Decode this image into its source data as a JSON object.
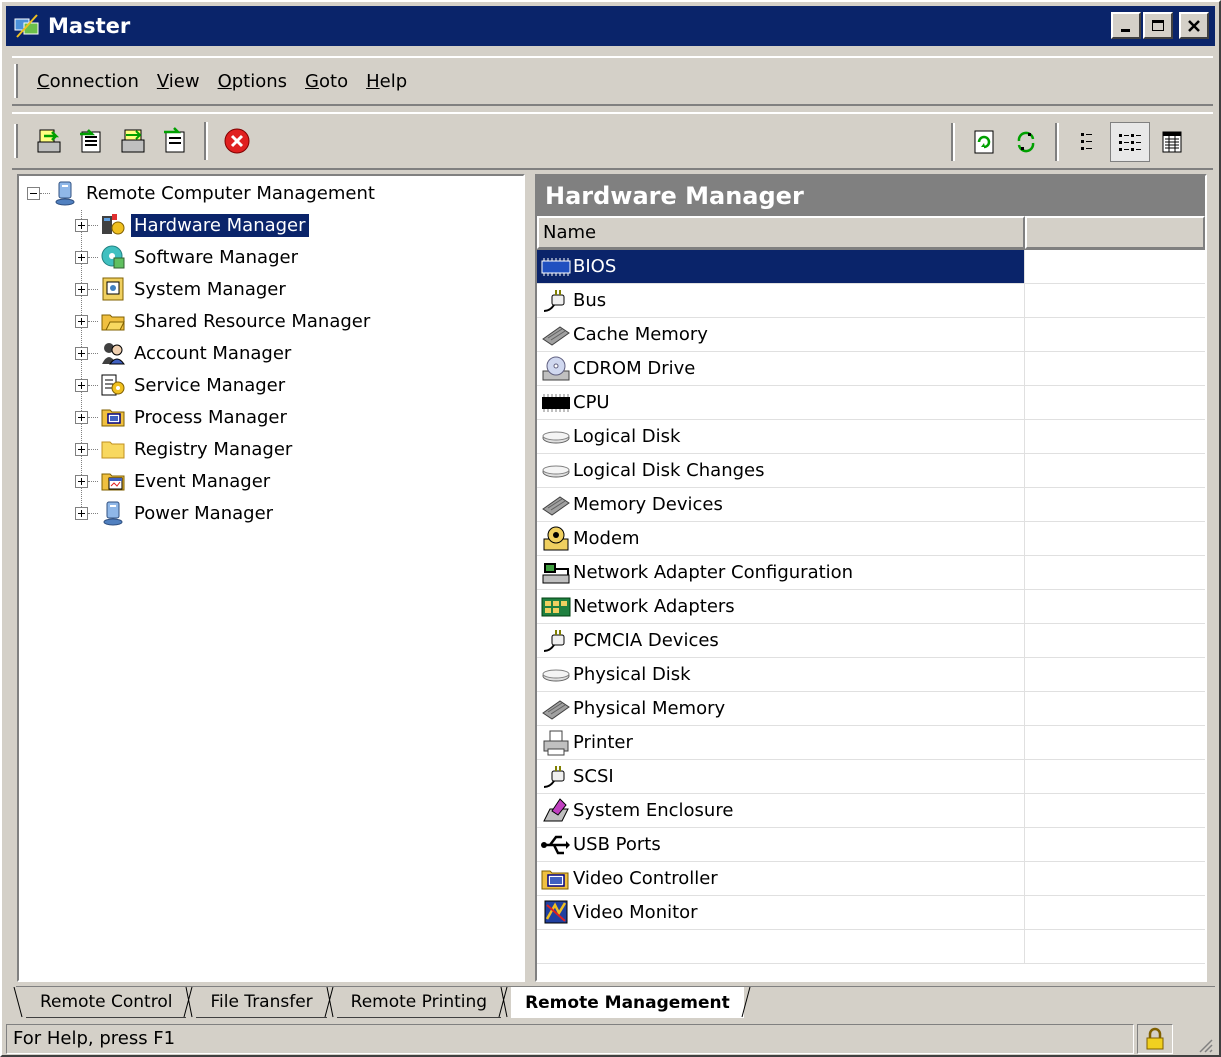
{
  "window": {
    "title": "Master"
  },
  "menu": [
    {
      "pre": "",
      "u": "C",
      "post": "onnection"
    },
    {
      "pre": "",
      "u": "V",
      "post": "iew"
    },
    {
      "pre": "",
      "u": "O",
      "post": "ptions"
    },
    {
      "pre": "",
      "u": "G",
      "post": "oto"
    },
    {
      "pre": "",
      "u": "H",
      "post": "elp"
    }
  ],
  "toolbar": {
    "left_buttons": [
      "connect-icon",
      "disconnect-icon",
      "connect-all-icon",
      "properties-icon",
      "stop-icon"
    ],
    "right_buttons": [
      "refresh-icon",
      "refresh-all-icon",
      "list-view-icon",
      "details-view-icon",
      "report-view-icon"
    ]
  },
  "tree": {
    "root": "Remote Computer Management",
    "items": [
      {
        "label": "Hardware Manager",
        "icon": "hardware-manager-icon",
        "selected": true
      },
      {
        "label": "Software Manager",
        "icon": "software-manager-icon"
      },
      {
        "label": "System Manager",
        "icon": "system-manager-icon"
      },
      {
        "label": "Shared Resource Manager",
        "icon": "shared-resource-icon"
      },
      {
        "label": "Account Manager",
        "icon": "account-manager-icon"
      },
      {
        "label": "Service Manager",
        "icon": "service-manager-icon"
      },
      {
        "label": "Process Manager",
        "icon": "process-manager-icon"
      },
      {
        "label": "Registry Manager",
        "icon": "registry-manager-icon"
      },
      {
        "label": "Event Manager",
        "icon": "event-manager-icon"
      },
      {
        "label": "Power Manager",
        "icon": "power-manager-icon"
      }
    ]
  },
  "panel": {
    "title": "Hardware Manager",
    "columns": [
      "Name",
      ""
    ],
    "rows": [
      {
        "name": "BIOS",
        "icon": "bios-chip-icon",
        "selected": true
      },
      {
        "name": "Bus",
        "icon": "bus-plug-icon"
      },
      {
        "name": "Cache Memory",
        "icon": "memory-module-icon"
      },
      {
        "name": "CDROM Drive",
        "icon": "cdrom-icon"
      },
      {
        "name": "CPU",
        "icon": "cpu-chip-icon"
      },
      {
        "name": "Logical Disk",
        "icon": "disk-icon"
      },
      {
        "name": "Logical Disk Changes",
        "icon": "disk-icon"
      },
      {
        "name": "Memory Devices",
        "icon": "memory-module-icon"
      },
      {
        "name": "Modem",
        "icon": "modem-icon"
      },
      {
        "name": "Network Adapter Configuration",
        "icon": "network-config-icon"
      },
      {
        "name": "Network Adapters",
        "icon": "network-adapter-icon"
      },
      {
        "name": "PCMCIA Devices",
        "icon": "bus-plug-icon"
      },
      {
        "name": "Physical Disk",
        "icon": "disk-icon"
      },
      {
        "name": "Physical Memory",
        "icon": "memory-module-icon"
      },
      {
        "name": "Printer",
        "icon": "printer-icon"
      },
      {
        "name": "SCSI",
        "icon": "bus-plug-icon"
      },
      {
        "name": "System Enclosure",
        "icon": "system-enclosure-icon"
      },
      {
        "name": "USB Ports",
        "icon": "usb-icon"
      },
      {
        "name": "Video Controller",
        "icon": "video-controller-icon"
      },
      {
        "name": "Video Monitor",
        "icon": "video-monitor-icon"
      }
    ]
  },
  "tabs": [
    {
      "label": "Remote Control",
      "active": false
    },
    {
      "label": "File Transfer",
      "active": false
    },
    {
      "label": "Remote Printing",
      "active": false
    },
    {
      "label": "Remote Management",
      "active": true
    }
  ],
  "status": {
    "text": "For Help, press F1"
  },
  "colors": {
    "titlebar": "#0a246a",
    "selection": "#0a246a",
    "panel_header": "#808080",
    "face": "#d4d0c8"
  }
}
